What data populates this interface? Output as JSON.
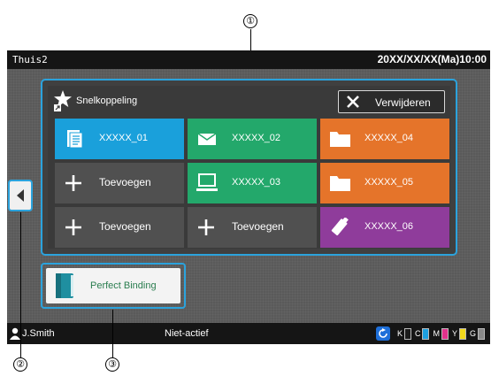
{
  "callouts": {
    "one": "①",
    "two": "②",
    "three": "③"
  },
  "topbar": {
    "title": "Thuis2",
    "datetime": "20XX/XX/XX(Ma)10:00"
  },
  "panel": {
    "title": "Snelkoppeling",
    "delete_label": "Verwijderen",
    "tiles": [
      {
        "label": "XXXXX_01",
        "icon": "document-icon",
        "color": "#1aa0db"
      },
      {
        "label": "XXXXX_02",
        "icon": "envelope-icon",
        "color": "#23a86b"
      },
      {
        "label": "XXXXX_04",
        "icon": "folder-icon",
        "color": "#e5742a"
      },
      {
        "label": "Toevoegen",
        "icon": "plus-icon",
        "color": "#505050"
      },
      {
        "label": "XXXXX_03",
        "icon": "computer-icon",
        "color": "#23a86b"
      },
      {
        "label": "XXXXX_05",
        "icon": "folder-icon",
        "color": "#e5742a"
      },
      {
        "label": "Toevoegen",
        "icon": "plus-icon",
        "color": "#505050"
      },
      {
        "label": "Toevoegen",
        "icon": "plus-icon",
        "color": "#505050"
      },
      {
        "label": "XXXXX_06",
        "icon": "usb-icon",
        "color": "#8f3c9b"
      }
    ]
  },
  "perfect_binding": {
    "label": "Perfect Binding"
  },
  "bottombar": {
    "user": "J.Smith",
    "status": "Niet-actief",
    "inks": [
      {
        "letter": "K",
        "color": "#111111"
      },
      {
        "letter": "C",
        "color": "#1ea0e0"
      },
      {
        "letter": "M",
        "color": "#e0328c"
      },
      {
        "letter": "Y",
        "color": "#f2d81c"
      },
      {
        "letter": "G",
        "color": "#888888"
      }
    ]
  },
  "colors": {
    "accent": "#2ba3dd",
    "screen_bg": "#5a5a5a"
  }
}
